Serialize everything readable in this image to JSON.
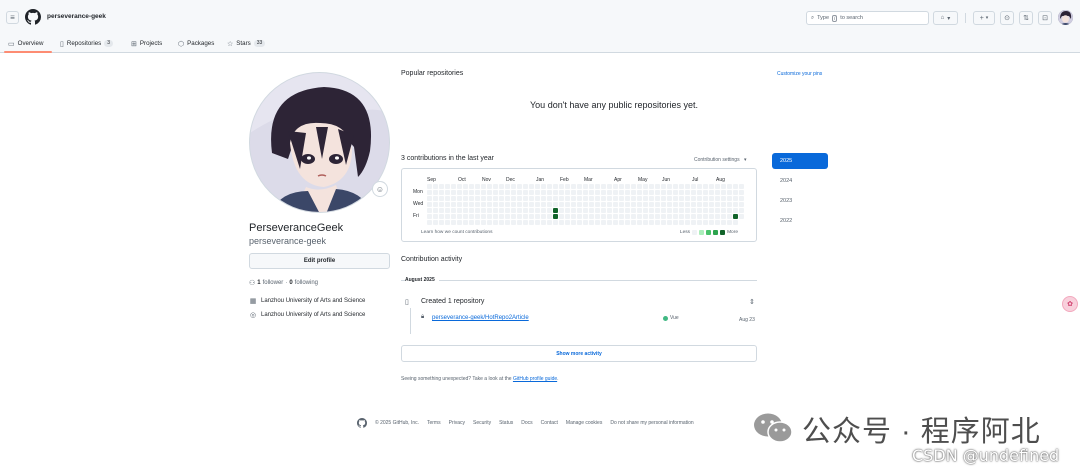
{
  "header": {
    "owner": "perseverance-geek",
    "search_prefix": "Type",
    "search_key": "/",
    "search_suffix": "to search"
  },
  "tabs": [
    {
      "label": "Overview",
      "icon": "book-icon"
    },
    {
      "label": "Repositories",
      "icon": "repo-icon",
      "count": "3"
    },
    {
      "label": "Projects",
      "icon": "table-icon"
    },
    {
      "label": "Packages",
      "icon": "package-icon"
    },
    {
      "label": "Stars",
      "icon": "star-icon",
      "count": "33"
    }
  ],
  "profile": {
    "display_name": "PerseveranceGeek",
    "login": "perseverance-geek",
    "edit_label": "Edit profile",
    "followers_count": "1",
    "followers_label": "follower",
    "following_count": "0",
    "following_label": "following",
    "organization": "Lanzhou University of Arts and Science",
    "location": "Lanzhou University of Arts and Science"
  },
  "popular": {
    "title": "Popular repositories",
    "customize": "Customize your pins",
    "empty": "You don't have any public repositories yet."
  },
  "contributions": {
    "title": "3 contributions in the last year",
    "settings": "Contribution settings",
    "months": [
      "Sep",
      "Oct",
      "Nov",
      "Dec",
      "Jan",
      "Feb",
      "Mar",
      "Apr",
      "May",
      "Jun",
      "Jul",
      "Aug"
    ],
    "days": [
      "Mon",
      "Wed",
      "Fri"
    ],
    "learn": "Learn how we count contributions",
    "less": "Less",
    "more": "More",
    "weeks": 53,
    "active_cells": [
      {
        "week": 21,
        "day": 4,
        "level": 4
      },
      {
        "week": 21,
        "day": 5,
        "level": 4
      },
      {
        "week": 51,
        "day": 5,
        "level": 4
      }
    ],
    "level_colors": [
      "#eff2f5",
      "#aceebb",
      "#4ac26b",
      "#2da44e",
      "#116329"
    ]
  },
  "years": [
    "2025",
    "2024",
    "2023",
    "2022"
  ],
  "activity": {
    "title": "Contribution activity",
    "month": "August 2025",
    "created": "Created 1 repository",
    "repo": "perseverance-geek/HotRepo2Article",
    "language": "Vue",
    "date": "Aug 23",
    "show_more": "Show more activity",
    "unexpected_text": "Seeing something unexpected? Take a look at the",
    "guide_link": "GitHub profile guide",
    "unexpected_end": "."
  },
  "footer": {
    "copyright": "© 2025 GitHub, Inc.",
    "links": [
      "Terms",
      "Privacy",
      "Security",
      "Status",
      "Docs",
      "Contact",
      "Manage cookies",
      "Do not share my personal information"
    ]
  },
  "watermark": {
    "text": "公众号 · 程序阿北",
    "csdn": "CSDN @undefined"
  },
  "colors": {
    "accent": "#0969da",
    "tab_underline": "#fd8c73",
    "vue": "#41b883"
  }
}
